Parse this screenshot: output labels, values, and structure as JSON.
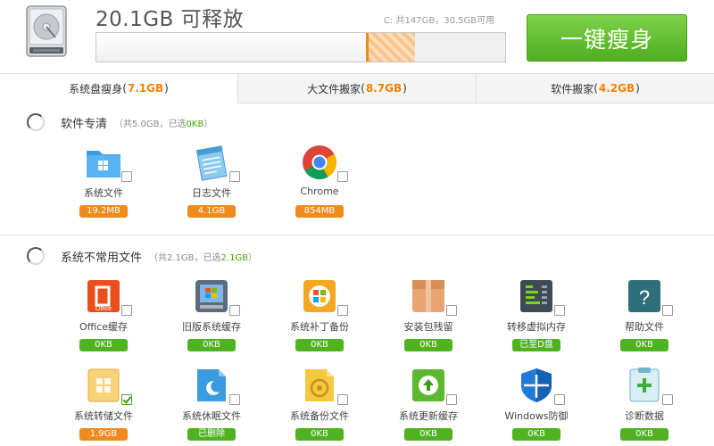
{
  "header": {
    "free_title": "20.1GB 可释放",
    "drive_info": "C: 共147GB，30.5GB可用",
    "slim_button": "一键瘦身",
    "progress": {
      "used_percent": 66.5,
      "cleanable_percent": 11.5
    }
  },
  "tabs": [
    {
      "label": "系统盘瘦身",
      "amount": "7.1GB",
      "active": true
    },
    {
      "label": "大文件搬家",
      "amount": "8.7GB",
      "active": false
    },
    {
      "label": "软件搬家",
      "amount": "4.2GB",
      "active": false
    }
  ],
  "sections": [
    {
      "title": "软件专清",
      "sub_prefix": "（共5.0GB，已选",
      "sub_selected": "0KB",
      "sub_suffix": "）",
      "items": [
        {
          "label": "系统文件",
          "size": "19.2MB",
          "badge": "orange",
          "icon": "folder-windows-icon",
          "checked": false
        },
        {
          "label": "日志文件",
          "size": "4.1GB",
          "badge": "orange",
          "icon": "log-notepad-icon",
          "checked": false
        },
        {
          "label": "Chrome",
          "size": "854MB",
          "badge": "orange",
          "icon": "chrome-icon",
          "checked": false
        }
      ]
    },
    {
      "title": "系统不常用文件",
      "sub_prefix": "（共2.1GB，已选",
      "sub_selected": "2.1GB",
      "sub_suffix": "）",
      "items": [
        {
          "label": "Office缓存",
          "size": "0KB",
          "badge": "green",
          "icon": "office-icon",
          "checked": false
        },
        {
          "label": "旧版系统缓存",
          "size": "0KB",
          "badge": "green",
          "icon": "old-windows-icon",
          "checked": false
        },
        {
          "label": "系统补丁备份",
          "size": "0KB",
          "badge": "green",
          "icon": "patch-backup-icon",
          "checked": false
        },
        {
          "label": "安装包残留",
          "size": "0KB",
          "badge": "green",
          "icon": "package-box-icon",
          "checked": false
        },
        {
          "label": "转移虚拟内存",
          "size": "已至D盘",
          "badge": "green",
          "icon": "virtual-memory-icon",
          "checked": false
        },
        {
          "label": "帮助文件",
          "size": "0KB",
          "badge": "green",
          "icon": "help-file-icon",
          "checked": false
        },
        {
          "label": "系统转储文件",
          "size": "1.9GB",
          "badge": "orange",
          "icon": "dump-file-icon",
          "checked": true
        },
        {
          "label": "系统休眠文件",
          "size": "已删除",
          "badge": "green",
          "icon": "hibernate-file-icon",
          "checked": false
        },
        {
          "label": "系统备份文件",
          "size": "0KB",
          "badge": "green",
          "icon": "system-backup-icon",
          "checked": false
        },
        {
          "label": "系统更新缓存",
          "size": "0KB",
          "badge": "green",
          "icon": "update-cache-icon",
          "checked": false
        },
        {
          "label": "Windows防御",
          "size": "0KB",
          "badge": "green",
          "icon": "windows-defender-icon",
          "checked": false
        },
        {
          "label": "诊断数据",
          "size": "0KB",
          "badge": "green",
          "icon": "diagnostic-data-icon",
          "checked": false
        }
      ]
    }
  ],
  "colors": {
    "accent_green": "#4fb320",
    "accent_orange": "#f08a1c"
  }
}
